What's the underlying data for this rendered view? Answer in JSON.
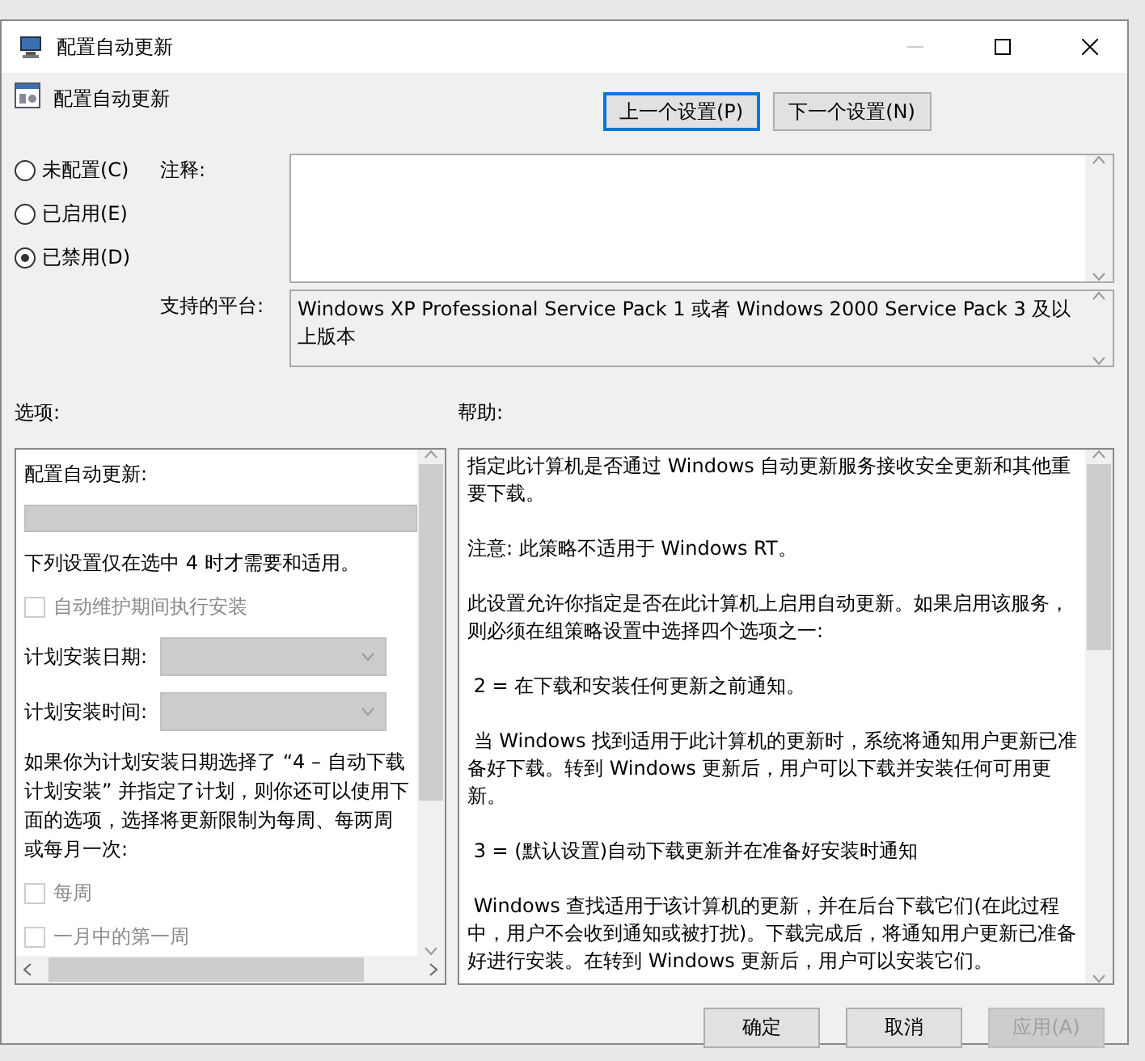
{
  "window": {
    "title": "配置自动更新"
  },
  "header": {
    "title": "配置自动更新"
  },
  "nav_buttons": [
    {
      "label": "上一个设置(P)",
      "selected": true
    },
    {
      "label": "下一个设置(N)",
      "selected": false
    }
  ],
  "state_options": [
    {
      "label": "未配置(C)",
      "selected": false
    },
    {
      "label": "已启用(E)",
      "selected": false
    },
    {
      "label": "已禁用(D)",
      "selected": true
    }
  ],
  "comment": {
    "label": "注释:"
  },
  "platform": {
    "label": "支持的平台:",
    "value": "Windows XP Professional Service Pack 1 或者 Windows 2000 Service Pack 3 及以上版本"
  },
  "options": {
    "label": "选项:",
    "items": [
      {
        "kind": "text",
        "text": "配置自动更新:"
      },
      {
        "kind": "select_wide"
      },
      {
        "kind": "text",
        "text": "下列设置仅在选中 4 时才需要和适用。"
      },
      {
        "kind": "checkbox",
        "text": "自动维护期间执行安装",
        "checked": false,
        "disabled": true
      },
      {
        "kind": "select",
        "text": "计划安装日期:"
      },
      {
        "kind": "select",
        "text": "计划安装时间:"
      },
      {
        "kind": "text",
        "text": "如果你为计划安装日期选择了 “4 – 自动下载计划安装” 并指定了计划，则你还可以使用下面的选项，选择将更新限制为每周、每两周或每月一次:"
      },
      {
        "kind": "checkbox",
        "text": "每周",
        "checked": false,
        "disabled": true
      },
      {
        "kind": "checkbox",
        "text": "一月中的第一周",
        "checked": false,
        "disabled": true
      }
    ]
  },
  "help": {
    "label": "帮助:",
    "paragraphs": [
      "指定此计算机是否通过 Windows 自动更新服务接收安全更新和其他重要下载。",
      "注意: 此策略不适用于 Windows RT。",
      "此设置允许你指定是否在此计算机上启用自动更新。如果启用该服务，则必须在组策略设置中选择四个选项之一:",
      " 2 = 在下载和安装任何更新之前通知。",
      " 当 Windows 找到适用于此计算机的更新时，系统将通知用户更新已准备好下载。转到 Windows 更新后，用户可以下载并安装任何可用更新。",
      " 3 = (默认设置)自动下载更新并在准备好安装时通知",
      " Windows 查找适用于该计算机的更新，并在后台下载它们(在此过程中，用户不会收到通知或被打扰)。下载完成后，将通知用户更新已准备好进行安装。在转到 Windows 更新后，用户可以安装它们。"
    ]
  },
  "footer_buttons": [
    {
      "label": "确定",
      "disabled": false
    },
    {
      "label": "取消",
      "disabled": false
    },
    {
      "label": "应用(A)",
      "disabled": true
    }
  ]
}
